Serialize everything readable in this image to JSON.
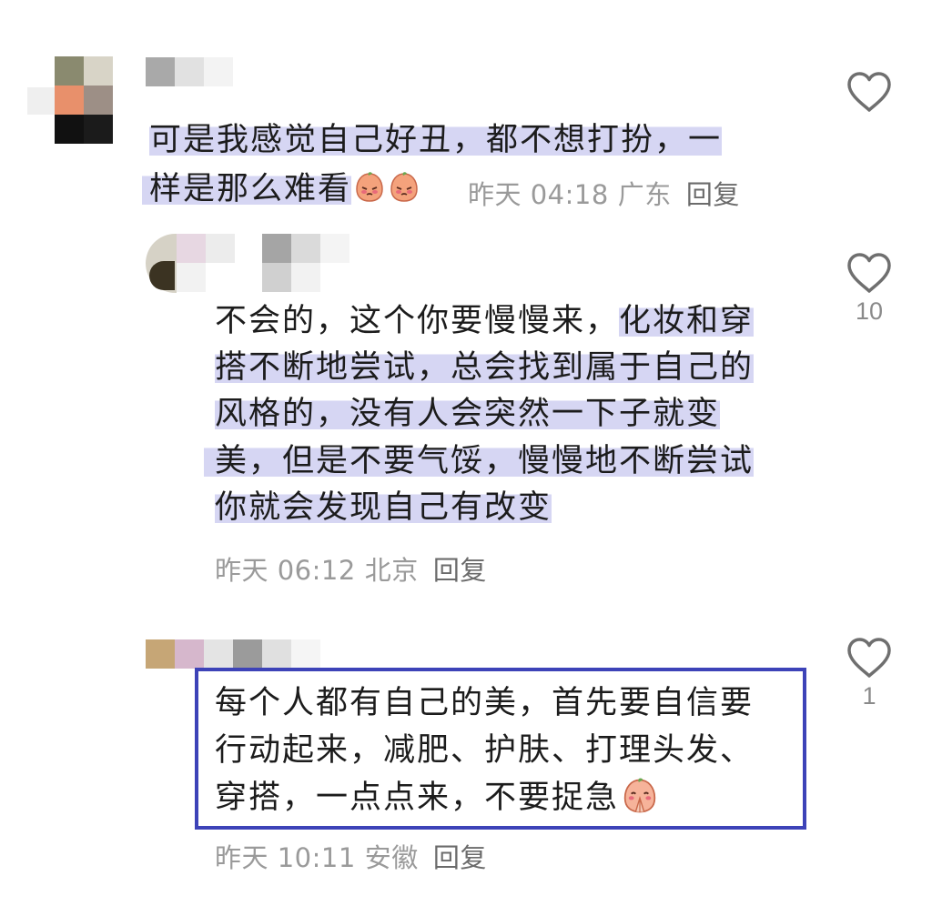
{
  "comments": [
    {
      "text_line1": "可是我感觉自己好丑，都不想打扮，一",
      "text_line2": "样是那么难看",
      "time": "昨天 04:18",
      "location": "广东",
      "reply": "回复",
      "likes": ""
    },
    {
      "line1_plain": "不会的，这个你要慢慢来，",
      "line1_hl": "化妆和穿",
      "line2": "搭不断地尝试，总会找到属于自己的",
      "line3": "风格的，没有人会突然一下子就变",
      "line4": "美，但是不要气馁，慢慢地不断尝试",
      "line5": "你就会发现自己有改变",
      "time": "昨天 06:12",
      "location": "北京",
      "reply": "回复",
      "likes": "10"
    },
    {
      "line1": "每个人都有自己的美，首先要自信要",
      "line2": "行动起来，减肥、护肤、打理头发、",
      "line3": "穿搭，一点点来，不要捉急",
      "time": "昨天 10:11",
      "location": "安徽",
      "reply": "回复",
      "likes": "1"
    }
  ],
  "icons": {
    "like": "heart-outline-icon",
    "sad_emoji": "sad-peach-emoji",
    "pray_emoji": "praying-peach-emoji"
  },
  "colors": {
    "highlight": "#d6d6f3",
    "box": "#3d43b8",
    "meta": "#9a9a9a"
  }
}
